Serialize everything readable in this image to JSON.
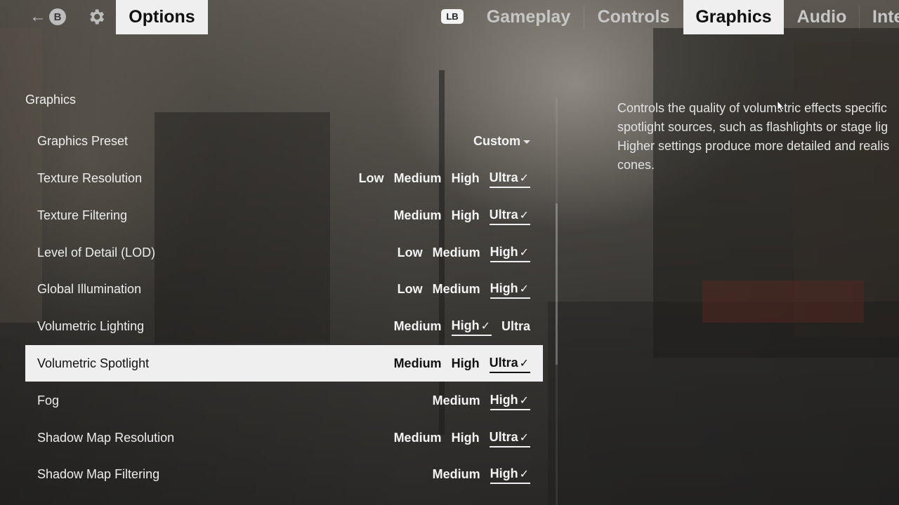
{
  "header": {
    "back_key": "B",
    "options_label": "Options",
    "tab_key": "LB",
    "tabs": [
      {
        "label": "Gameplay",
        "active": false
      },
      {
        "label": "Controls",
        "active": false
      },
      {
        "label": "Graphics",
        "active": true
      },
      {
        "label": "Audio",
        "active": false
      },
      {
        "label": "Inte",
        "active": false
      }
    ]
  },
  "section_title": "Graphics",
  "preset": {
    "label": "Graphics Preset",
    "value": "Custom"
  },
  "settings": [
    {
      "label": "Texture Resolution",
      "options": [
        "Low",
        "Medium",
        "High",
        "Ultra"
      ],
      "selected": "Ultra"
    },
    {
      "label": "Texture Filtering",
      "options": [
        "Medium",
        "High",
        "Ultra"
      ],
      "selected": "Ultra"
    },
    {
      "label": "Level of Detail (LOD)",
      "options": [
        "Low",
        "Medium",
        "High"
      ],
      "selected": "High"
    },
    {
      "label": "Global Illumination",
      "options": [
        "Low",
        "Medium",
        "High"
      ],
      "selected": "High"
    },
    {
      "label": "Volumetric Lighting",
      "options": [
        "Medium",
        "High",
        "Ultra"
      ],
      "selected": "High"
    },
    {
      "label": "Volumetric Spotlight",
      "options": [
        "Medium",
        "High",
        "Ultra"
      ],
      "selected": "Ultra",
      "focused": true
    },
    {
      "label": "Fog",
      "options": [
        "Medium",
        "High"
      ],
      "selected": "High"
    },
    {
      "label": "Shadow Map Resolution",
      "options": [
        "Medium",
        "High",
        "Ultra"
      ],
      "selected": "Ultra"
    },
    {
      "label": "Shadow Map Filtering",
      "options": [
        "Medium",
        "High"
      ],
      "selected": "High"
    }
  ],
  "description": [
    "Controls the quality of volumetric effects specific",
    "spotlight sources, such as flashlights or stage lig",
    "Higher settings produce more detailed and realis",
    "cones."
  ],
  "check_glyph": "✓",
  "colors": {
    "highlight_bg": "#efefef",
    "text": "#f2f2f2",
    "text_on_highlight": "#111111"
  }
}
